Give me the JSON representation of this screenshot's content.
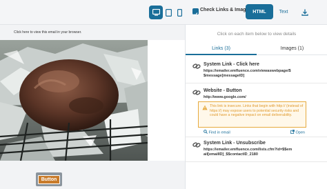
{
  "toolbar": {
    "check_links_label": "Check Links & Images",
    "html_label": "HTML",
    "text_label": "Text",
    "accent_color": "#1a6e99"
  },
  "preview": {
    "view_in_browser": "Click here to view this email in your browser.",
    "button_label": "Button"
  },
  "panel": {
    "header": "Click on each item below to view details",
    "tabs": [
      {
        "label": "Links (3)",
        "active": true
      },
      {
        "label": "Images (1)",
        "active": false
      }
    ],
    "links": [
      {
        "title": "System Link - Click here",
        "url": "https://emailer.emfluence.com/viewaswebpage/$ $message[messageID]"
      },
      {
        "title": "Website - Button",
        "url": "http://www.google.com/",
        "warning": "This link is insecure. Links that begin with http:// (instead of https://) may expose users to potential security risks and could have a negative impact on email deliverability.",
        "find_label": "Find in email",
        "open_label": "Open"
      },
      {
        "title": "System Link - Unsubscribe",
        "url": "https://emailer.emfluence.com/lists.cfm?id=$$em ail[emailID]_$$contactID_2180"
      }
    ]
  },
  "icons": [
    "desktop-icon",
    "tablet-icon",
    "mobile-icon",
    "checkbox-icon",
    "download-icon",
    "link-icon",
    "warning-icon",
    "search-icon",
    "external-link-icon"
  ]
}
